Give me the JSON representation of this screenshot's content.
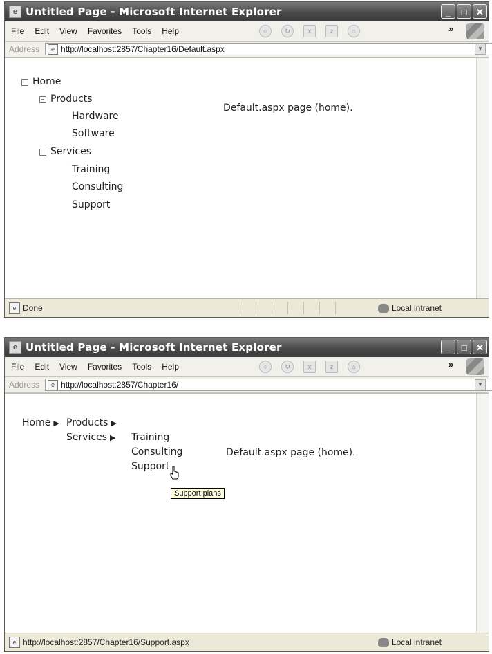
{
  "window_title": "Untitled Page - Microsoft Internet Explorer",
  "menu": [
    "File",
    "Edit",
    "View",
    "Favorites",
    "Tools",
    "Help"
  ],
  "address_label": "Address",
  "screen1": {
    "address": "http://localhost:2857/Chapter16/Default.aspx",
    "tree": {
      "home": "Home",
      "products": "Products",
      "hardware": "Hardware",
      "software": "Software",
      "services": "Services",
      "training": "Training",
      "consulting": "Consulting",
      "support": "Support"
    },
    "page_text": "Default.aspx page (home).",
    "status": "Done",
    "zone": "Local intranet"
  },
  "screen2": {
    "address": "http://localhost:2857/Chapter16/",
    "menu": {
      "home": "Home",
      "products": "Products",
      "services": "Services",
      "training": "Training",
      "consulting": "Consulting",
      "support": "Support"
    },
    "page_text": "Default.aspx page (home).",
    "tooltip": "Support plans",
    "status": "http://localhost:2857/Chapter16/Support.aspx",
    "zone": "Local intranet"
  }
}
